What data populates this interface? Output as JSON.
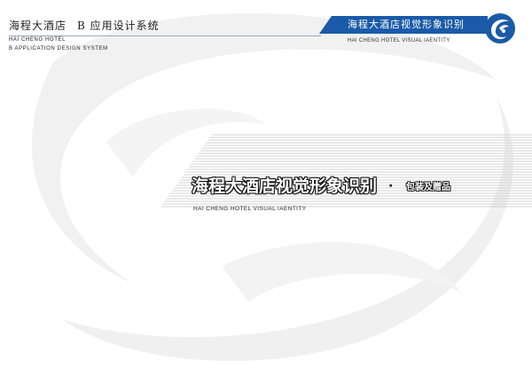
{
  "header": {
    "left_title_cn": "海程大酒店",
    "left_section_cn": "B 应用设计系统",
    "left_en_line1": "HAI CHENG HOTEL",
    "left_en_line2": "B  APPLICATION DESIGN SYSTEM"
  },
  "banner": {
    "title_cn": "海程大酒店视觉形象识别",
    "subtitle_en": "HAI CHENG HOTEL VISUAL IAENTITY",
    "logo_icon": "swirl-logo-icon",
    "color": "#1a5aa8"
  },
  "main": {
    "title_cn": "海程大酒店视觉形象识别",
    "separator": "·",
    "subtitle_cn": "包装及赠品",
    "title_en": "HAI CHENG HOTEL VISUAL IAENTITY"
  }
}
